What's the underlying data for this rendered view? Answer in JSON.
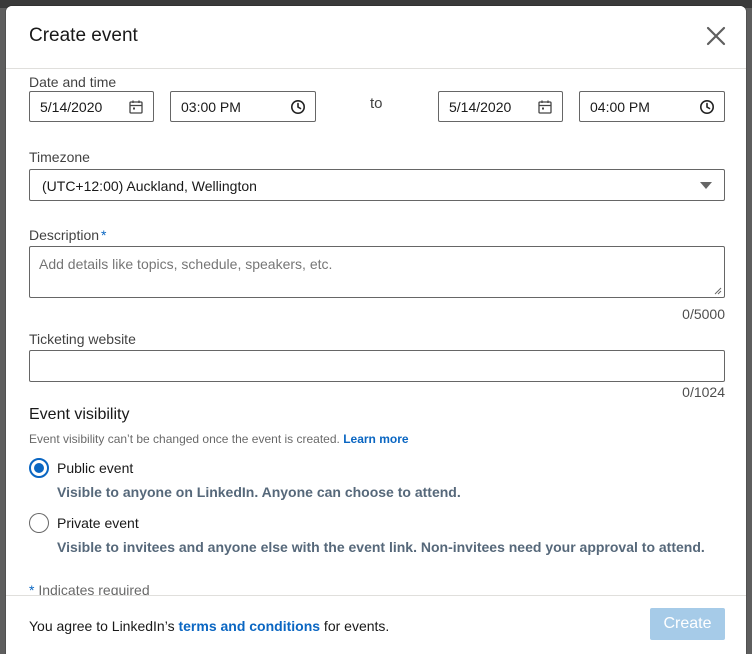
{
  "modal": {
    "title": "Create event",
    "close_label": "Close"
  },
  "date_time": {
    "label": "Date and time",
    "start_date": "5/14/2020",
    "start_time": "03:00 PM",
    "to_label": "to",
    "end_date": "5/14/2020",
    "end_time": "04:00 PM"
  },
  "timezone": {
    "label": "Timezone",
    "selected": "(UTC+12:00) Auckland, Wellington"
  },
  "description": {
    "label": "Description",
    "required_mark": "*",
    "placeholder": "Add details like topics, schedule, speakers, etc.",
    "counter": "0/5000"
  },
  "ticketing": {
    "label": "Ticketing website",
    "value": "",
    "counter": "0/1024"
  },
  "visibility": {
    "title": "Event visibility",
    "note": "Event visibility can’t be changed once the event is created.",
    "learn_more": "Learn more",
    "options": [
      {
        "label": "Public event",
        "description": "Visible to anyone on LinkedIn. Anyone can choose to attend.",
        "checked": true
      },
      {
        "label": "Private event",
        "description": "Visible to invitees and anyone else with the event link. Non-invitees need your approval to attend.",
        "checked": false
      }
    ]
  },
  "required_note": {
    "star": "*",
    "text": " Indicates required"
  },
  "footer": {
    "agree_prefix": "You agree to LinkedIn’s ",
    "terms_link": "terms and conditions",
    "agree_suffix": " for events.",
    "create_label": "Create"
  },
  "colors": {
    "accent": "#0a66c2",
    "create_disabled": "#a6cbe8",
    "description_text": "#56687a"
  },
  "icons": {
    "close": "close-icon",
    "calendar": "calendar-icon",
    "clock": "clock-icon",
    "caret": "caret-down-icon"
  }
}
